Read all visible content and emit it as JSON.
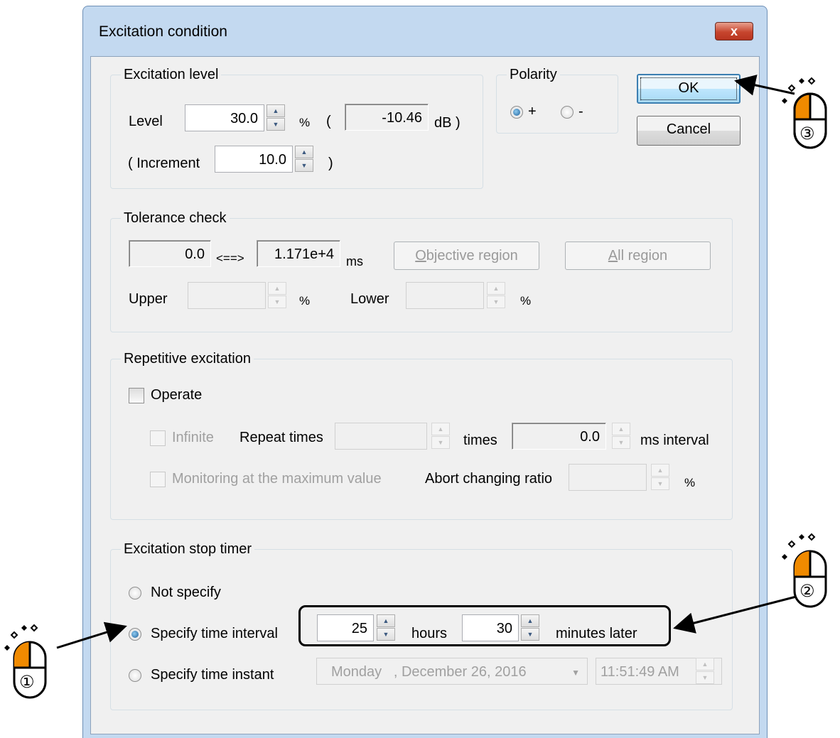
{
  "window": {
    "title": "Excitation condition",
    "close_glyph": "x"
  },
  "buttons": {
    "ok": "OK",
    "cancel": "Cancel"
  },
  "excitation_level": {
    "group_label": "Excitation level",
    "level_label": "Level",
    "level_value": "30.0",
    "pct": "%",
    "open_paren": "(",
    "db_value": "-10.46",
    "db_unit": "dB )",
    "increment_label": "( Increment",
    "increment_value": "10.0",
    "close_paren": ")"
  },
  "polarity": {
    "group_label": "Polarity",
    "plus": "+",
    "minus": "-",
    "selected": "+"
  },
  "tolerance": {
    "group_label": "Tolerance check",
    "from_value": "0.0",
    "arrow": "<==>",
    "to_value": "1.171e+4",
    "unit": "ms",
    "objective_btn": {
      "hotkey": "O",
      "rest": "bjective region"
    },
    "all_btn": {
      "hotkey": "A",
      "rest": "ll region"
    },
    "upper_label": "Upper",
    "upper_pct": "%",
    "lower_label": "Lower",
    "lower_pct": "%"
  },
  "repetitive": {
    "group_label": "Repetitive excitation",
    "operate_label": "Operate",
    "operate_checked": false,
    "infinite_label": "Infinite",
    "repeat_label": "Repeat times",
    "times_label": "times",
    "interval_value": "0.0",
    "interval_label": "ms interval",
    "monitoring_label": "Monitoring at the maximum value",
    "abort_label": "Abort changing ratio",
    "abort_pct": "%"
  },
  "stop_timer": {
    "group_label": "Excitation stop timer",
    "opt_not_specify": "Not specify",
    "opt_interval": "Specify time interval",
    "opt_instant": "Specify time instant",
    "selected": "Specify time interval",
    "hours_value": "25",
    "hours_label": "hours",
    "minutes_value": "30",
    "minutes_label": "minutes later",
    "date_day": "Monday",
    "date_rest": ", December 26, 2016",
    "time_value": "11:51:49 AM"
  },
  "annotations": {
    "step1": "①",
    "step2": "②",
    "step3": "③"
  },
  "colors": {
    "mouse_button": "#f08a00",
    "titlebar": "#c3d9f0",
    "close_button": "#c7452e",
    "dialog_bg": "#f0f0f0"
  }
}
